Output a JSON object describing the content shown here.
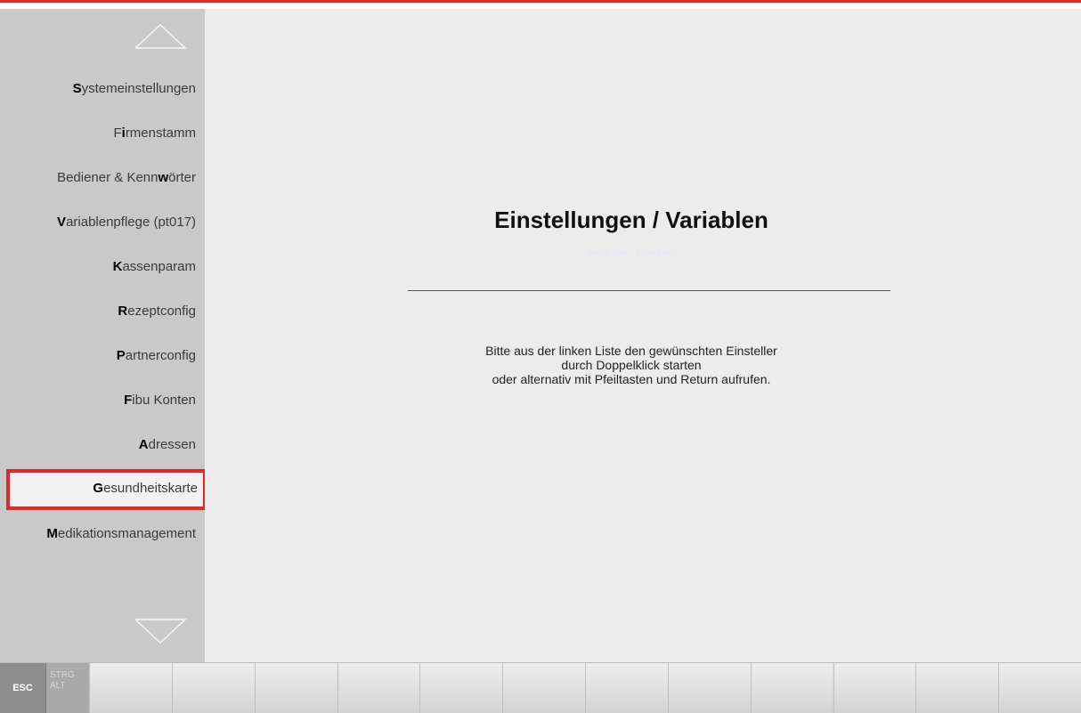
{
  "sidebar": {
    "items": [
      {
        "hotkey": "S",
        "rest": "ystemeinstellungen",
        "prefix": ""
      },
      {
        "hotkey": "i",
        "rest": "rmenstamm",
        "prefix": "F"
      },
      {
        "hotkey": "w",
        "rest": "örter",
        "prefix": "Bediener & Kenn"
      },
      {
        "hotkey": "V",
        "rest": "ariablenpflege (pt017)",
        "prefix": ""
      },
      {
        "hotkey": "K",
        "rest": "assenparam",
        "prefix": ""
      },
      {
        "hotkey": "R",
        "rest": "ezeptconfig",
        "prefix": ""
      },
      {
        "hotkey": "P",
        "rest": "artnerconfig",
        "prefix": ""
      },
      {
        "hotkey": "F",
        "rest": "ibu Konten",
        "prefix": ""
      },
      {
        "hotkey": "A",
        "rest": "dressen",
        "prefix": ""
      },
      {
        "hotkey": "G",
        "rest": "esundheitskarte",
        "prefix": ""
      },
      {
        "hotkey": "M",
        "rest": "edikationsmanagement",
        "prefix": ""
      }
    ],
    "selected_index": 9
  },
  "main": {
    "title": "Einstellungen / Variablen",
    "ghost_text": "Der Buyer · Einsteller",
    "info_lines": [
      "Bitte aus der linken Liste den gewünschten Einsteller",
      "durch Doppelklick starten",
      "oder alternativ mit Pfeiltasten und Return aufrufen."
    ]
  },
  "toolbar": {
    "esc_label": "ESC",
    "mod_label_1": "STRG",
    "mod_label_2": "ALT",
    "function_key_count": 12
  },
  "colors": {
    "accent": "#e5262b",
    "sidebar_bg": "#c9c9c9",
    "main_bg": "#ececec"
  }
}
